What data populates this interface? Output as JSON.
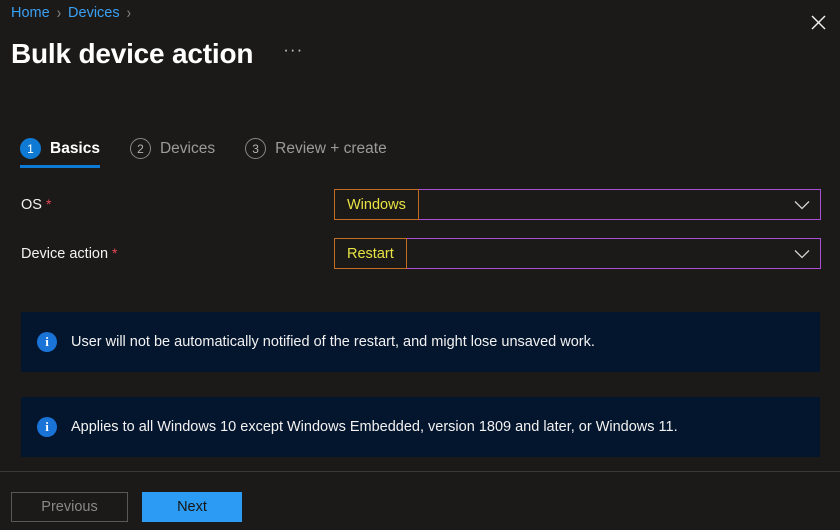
{
  "breadcrumb": {
    "items": [
      {
        "label": "Home"
      },
      {
        "label": "Devices"
      }
    ],
    "separator": "›"
  },
  "header": {
    "title": "Bulk device action",
    "more_label": "···",
    "close_icon": "close-icon"
  },
  "wizard": {
    "steps": [
      {
        "number": "1",
        "label": "Basics",
        "state": "active"
      },
      {
        "number": "2",
        "label": "Devices",
        "state": "inactive"
      },
      {
        "number": "3",
        "label": "Review + create",
        "state": "inactive"
      }
    ]
  },
  "form": {
    "fields": [
      {
        "label": "OS",
        "required_marker": "*",
        "value": "Windows",
        "chevron_icon": "chevron-down-icon"
      },
      {
        "label": "Device action",
        "required_marker": "*",
        "value": "Restart",
        "chevron_icon": "chevron-down-icon"
      }
    ]
  },
  "banners": [
    {
      "icon": "info-icon",
      "icon_glyph": "i",
      "text": "User will not be automatically notified of the restart, and might lose unsaved work."
    },
    {
      "icon": "info-icon",
      "icon_glyph": "i",
      "text": "Applies to all Windows 10 except Windows Embedded, version 1809 and later, or Windows 11."
    }
  ],
  "footer": {
    "previous_label": "Previous",
    "next_label": "Next"
  },
  "colors": {
    "background": "#1b1a19",
    "accent_blue": "#0f7ad4",
    "link_blue": "#3aa0f3",
    "next_button": "#2b9bf4",
    "banner_background": "#04152e",
    "select_border": "#a84fd3",
    "value_border": "#c26d21",
    "value_text": "#e8e242",
    "required_red": "#e74856"
  }
}
